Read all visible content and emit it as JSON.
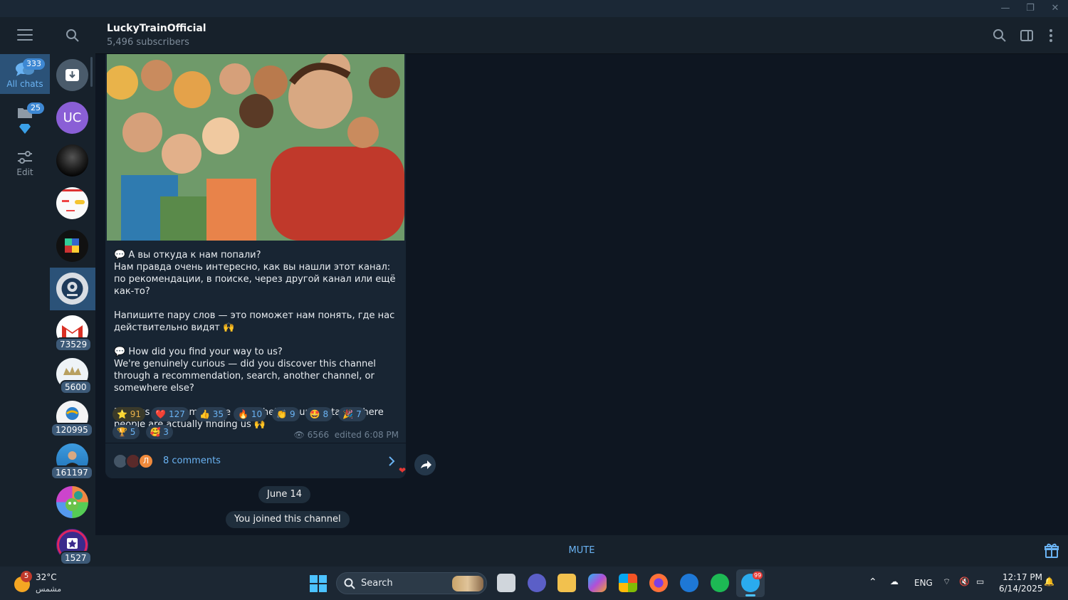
{
  "window": {
    "minimize": "—",
    "restore": "❐",
    "close": "✕"
  },
  "folders": [
    {
      "label": "All chats",
      "badge": "333",
      "icon": "chats-icon"
    },
    {
      "label": "",
      "badge": "25",
      "icon": "folder-icon"
    },
    {
      "label": "Edit",
      "badge": "",
      "icon": "edit-filters-icon"
    }
  ],
  "chat_list": {
    "avatars": [
      {
        "name": "archive",
        "initials": "",
        "badge": ""
      },
      {
        "name": "uc",
        "initials": "UC",
        "badge": ""
      },
      {
        "name": "dark-channel",
        "initials": "",
        "badge": ""
      },
      {
        "name": "receipt-channel",
        "initials": "",
        "badge": ""
      },
      {
        "name": "colorful-cube",
        "initials": "",
        "badge": ""
      },
      {
        "name": "luckytrain",
        "initials": "",
        "badge": ""
      },
      {
        "name": "gmail",
        "initials": "",
        "badge": "73529"
      },
      {
        "name": "crown",
        "initials": "",
        "badge": "5600"
      },
      {
        "name": "globe",
        "initials": "",
        "badge": "120995"
      },
      {
        "name": "person",
        "initials": "",
        "badge": "161197"
      },
      {
        "name": "game",
        "initials": "",
        "badge": ""
      },
      {
        "name": "star",
        "initials": "",
        "badge": "1527"
      }
    ]
  },
  "header": {
    "channel_name": "LuckyTrainOfficial",
    "subscribers": "5,496 subscribers"
  },
  "post": {
    "text_ru": [
      "💬 А вы откуда к нам попали?",
      "Нам правда очень интересно, как вы нашли этот канал: по рекомендации, в поиске, через другой канал или ещё как-то?"
    ],
    "text_ru_2": "Напишите пару слов — это поможет нам понять, где нас действительно видят 🙌",
    "text_en": [
      "💬 How did you find your way to us?",
      "We're genuinely curious — did you discover this channel through a recommendation, search, another channel, or somewhere else?"
    ],
    "text_en_2": "Drop us a quick message — it'll help us understand where people are actually finding us 🙌",
    "reactions": [
      {
        "emoji": "⭐",
        "count": "91"
      },
      {
        "emoji": "❤️",
        "count": "127"
      },
      {
        "emoji": "👍",
        "count": "35"
      },
      {
        "emoji": "🔥",
        "count": "10"
      },
      {
        "emoji": "👏",
        "count": "9"
      },
      {
        "emoji": "🤩",
        "count": "8"
      },
      {
        "emoji": "🎉",
        "count": "7"
      },
      {
        "emoji": "🏆",
        "count": "5"
      },
      {
        "emoji": "🥰",
        "count": "3"
      }
    ],
    "views": "6566",
    "edited": "edited 6:08 PM",
    "comments": "8 comments",
    "comment_avatar_letter": "Л"
  },
  "service": {
    "date": "June 14",
    "joined": "You joined this channel"
  },
  "bottom": {
    "mute": "MUTE"
  },
  "taskbar": {
    "weather_badge": "5",
    "temperature": "32°C",
    "weather_desc": "مشمس",
    "search": "Search",
    "lang": "ENG",
    "time": "12:17 PM",
    "date": "6/14/2025",
    "telegram_badge": "99"
  },
  "colors": {
    "accent": "#6ab3f3",
    "selected": "#2b5278",
    "bubble": "#182533",
    "bg": "#0e1621"
  }
}
